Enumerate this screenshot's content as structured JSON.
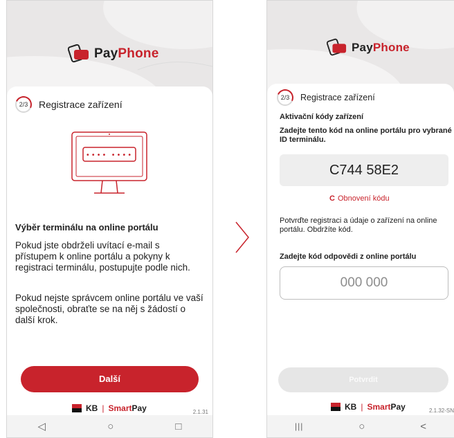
{
  "brand": {
    "name_part1": "Pay",
    "name_part2": "Phone",
    "accent": "#c8232c"
  },
  "screen1": {
    "step_label": "2/3",
    "step_title": "Registrace zařízení",
    "section_title": "Výběr terminálu na online portálu",
    "paragraph1": "Pokud jste obdrželi uvítací e-mail s přístupem k online portálu a pokyny k registraci terminálu, postupujte podle nich.",
    "paragraph2": "Pokud nejste správcem online portálu ve vaší společnosti, obraťte se na něj s žádostí o další krok.",
    "next_button": "Další",
    "footer_kb": "KB",
    "footer_sep": "|",
    "footer_smartpay_a": "Smart",
    "footer_smartpay_b": "Pay",
    "version": "2.1.31",
    "nav": {
      "back": "◁",
      "home": "○",
      "recent": "□"
    }
  },
  "screen2": {
    "step_label": "2/3",
    "step_title": "Registrace zařízení",
    "section_title": "Aktivační kódy zařízení",
    "instruction": "Zadejte tento kód na online portálu pro vybrané ID terminálu.",
    "activation_code": "C744 58E2",
    "refresh_link": "Obnovení kódu",
    "confirm_text": "Potvrďte registraci a údaje o zařízení na online portálu. Obdržíte kód.",
    "response_label": "Zadejte kód odpovědi z online portálu",
    "response_placeholder": "000 000",
    "confirm_button": "Potvrdit",
    "footer_kb": "KB",
    "footer_sep": "|",
    "footer_smartpay_a": "Smart",
    "footer_smartpay_b": "Pay",
    "version": "2.1.32-SN",
    "nav": {
      "recent": "|||",
      "home": "○",
      "back": "<"
    }
  },
  "arrow": "›"
}
